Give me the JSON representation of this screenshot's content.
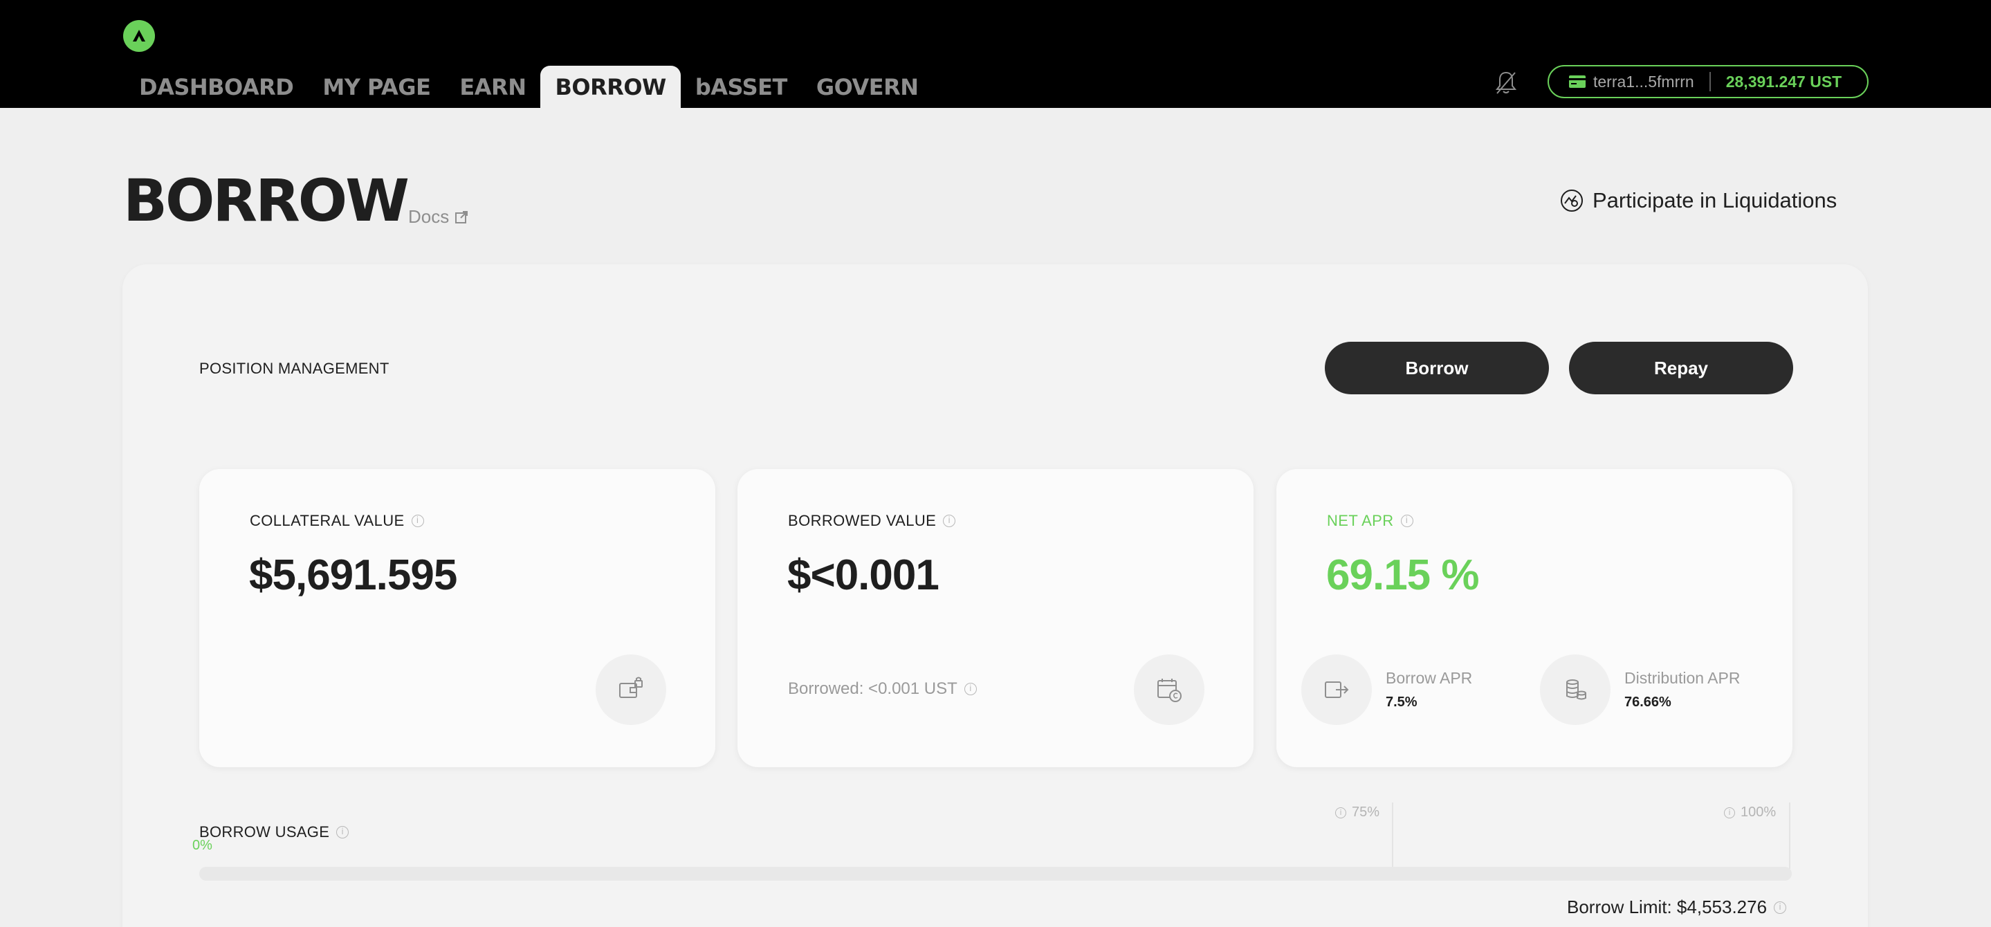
{
  "nav": {
    "tabs": [
      "DASHBOARD",
      "MY PAGE",
      "EARN",
      "BORROW",
      "bASSET",
      "GOVERN"
    ],
    "active": "BORROW"
  },
  "wallet": {
    "address": "terra1...5fmrrn",
    "balance": "28,391.247 UST"
  },
  "page": {
    "title": "BORROW",
    "docs_label": "Docs",
    "liquidations_label": "Participate in Liquidations"
  },
  "position": {
    "title": "POSITION MANAGEMENT",
    "borrow_label": "Borrow",
    "repay_label": "Repay"
  },
  "collateral": {
    "label": "COLLATERAL VALUE",
    "value": "$5,691.595"
  },
  "borrowed": {
    "label": "BORROWED VALUE",
    "value": "$<0.001",
    "sub": "Borrowed: <0.001 UST"
  },
  "net_apr": {
    "label": "NET APR",
    "value": "69.15 %",
    "borrow_apr_label": "Borrow APR",
    "borrow_apr_value": "7.5%",
    "distribution_apr_label": "Distribution APR",
    "distribution_apr_value": "76.66%"
  },
  "usage": {
    "label": "BORROW USAGE",
    "current": "0%",
    "tick_75": "75%",
    "tick_100": "100%",
    "borrow_limit": "Borrow Limit: $4,553.276"
  },
  "colors": {
    "accent": "#6ad15a",
    "dark": "#2b2b2b"
  }
}
